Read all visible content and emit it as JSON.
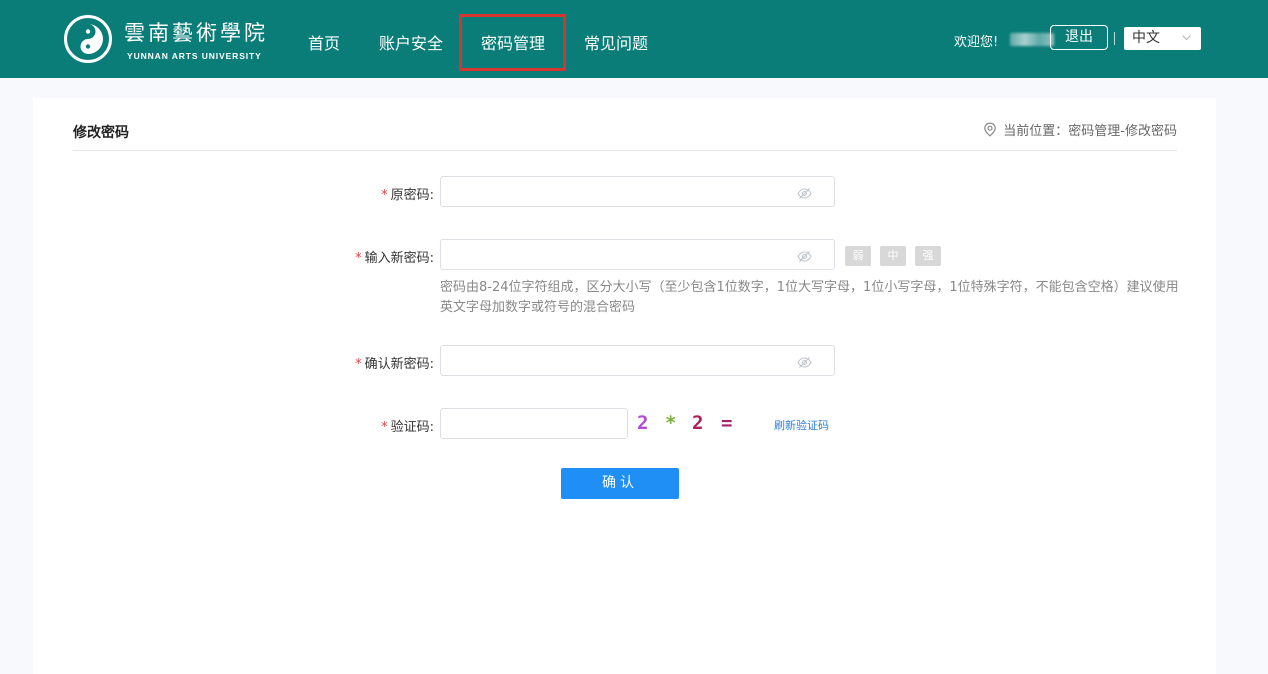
{
  "header": {
    "logo_cn": "雲南藝術學院",
    "logo_en": "YUNNAN ARTS UNIVERSITY",
    "nav": [
      {
        "label": "首页"
      },
      {
        "label": "账户安全"
      },
      {
        "label": "密码管理",
        "active": true
      },
      {
        "label": "常见问题"
      }
    ],
    "welcome": "欢迎您!",
    "logout_label": "退出",
    "language": "中文"
  },
  "colors": {
    "header_bg": "#0a7d79",
    "highlight_border": "#d6342c",
    "primary_button": "#1f8ff5",
    "required_mark": "#e64545",
    "link": "#2f7fd8"
  },
  "page": {
    "title": "修改密码",
    "breadcrumb": "当前位置：密码管理-修改密码",
    "breadcrumb_icon": "location-pin-icon"
  },
  "form": {
    "required_mark": "*",
    "old_password": {
      "label": "原密码:",
      "value": "",
      "placeholder": ""
    },
    "new_password": {
      "label": "输入新密码:",
      "value": "",
      "placeholder": ""
    },
    "strength": [
      "弱",
      "中",
      "强"
    ],
    "hint": "密码由8-24位字符组成，区分大小写（至少包含1位数字，1位大写字母，1位小写字母，1位特殊字符，不能包含空格）建议使用英文字母加数字或符号的混合密码",
    "confirm_password": {
      "label": "确认新密码:",
      "value": "",
      "placeholder": ""
    },
    "captcha": {
      "label": "验证码:",
      "value": "",
      "chars": [
        {
          "text": "2",
          "color": "#b24bd6"
        },
        {
          "text": "*",
          "color": "#7ab43c"
        },
        {
          "text": "2",
          "color": "#b0205a"
        },
        {
          "text": "=",
          "color": "#a3206a"
        }
      ],
      "refresh_label": "刷新验证码"
    },
    "submit_label": "确认"
  }
}
